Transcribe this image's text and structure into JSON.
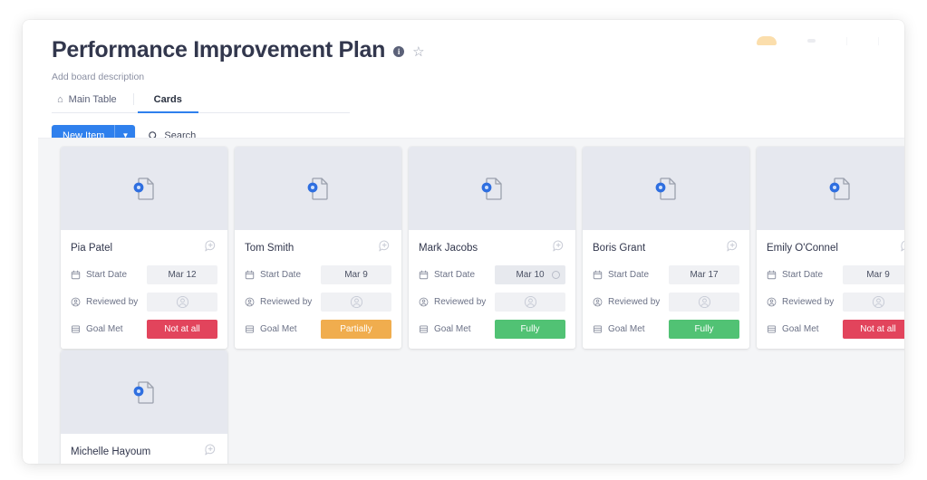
{
  "header": {
    "title": "Performance Improvement Plan",
    "info_icon": "info-icon",
    "star_icon": "star-outline-icon",
    "description": "Add board description"
  },
  "tabs": [
    {
      "label": "Main Table",
      "icon": "home-icon",
      "active": false
    },
    {
      "label": "Cards",
      "icon": "",
      "active": true
    }
  ],
  "toolbar": {
    "new_item_label": "New Item",
    "new_item_caret": "chevron-down-icon",
    "search_label": "Search",
    "search_icon": "search-icon"
  },
  "board": {
    "field_labels": {
      "start_date": "Start Date",
      "reviewed_by": "Reviewed by",
      "goal_met": "Goal Met"
    },
    "field_icons": {
      "start_date": "calendar-icon",
      "reviewed_by": "person-circle-icon",
      "goal_met": "status-lines-icon"
    },
    "thumb_icon": "file-placeholder-icon",
    "comment_icon": "add-comment-icon",
    "person_icon": "person-avatar-icon",
    "cards": [
      {
        "name": "Pia Patel",
        "start_date": "Mar 12",
        "date_hovered": false,
        "reviewed_by": "",
        "goal_met": "Not at all",
        "goal_color": "red",
        "truncated": false,
        "body_visible": true
      },
      {
        "name": "Tom Smith",
        "start_date": "Mar 9",
        "date_hovered": false,
        "reviewed_by": "",
        "goal_met": "Partially",
        "goal_color": "orange",
        "truncated": false,
        "body_visible": true
      },
      {
        "name": "Mark Jacobs",
        "start_date": "Mar 10",
        "date_hovered": true,
        "reviewed_by": "",
        "goal_met": "Fully",
        "goal_color": "green",
        "truncated": false,
        "body_visible": true
      },
      {
        "name": "Boris Grant",
        "start_date": "Mar 17",
        "date_hovered": false,
        "reviewed_by": "",
        "goal_met": "Fully",
        "goal_color": "green",
        "truncated": false,
        "body_visible": true
      },
      {
        "name": "Emily O'Connel",
        "start_date": "Mar 9",
        "date_hovered": false,
        "reviewed_by": "",
        "goal_met": "Not at all",
        "goal_color": "red",
        "truncated": true,
        "body_visible": true
      },
      {
        "name": "Michelle Hayoum",
        "start_date": "",
        "date_hovered": false,
        "reviewed_by": "",
        "goal_met": "",
        "goal_color": "",
        "truncated": false,
        "body_visible": false
      }
    ]
  },
  "colors": {
    "accent_blue": "#2f80ed",
    "status_red": "#e2445c",
    "status_orange": "#f0ad4e",
    "status_green": "#51c274",
    "board_bg": "#f4f5f7",
    "thumb_bg": "#e6e8ef"
  }
}
